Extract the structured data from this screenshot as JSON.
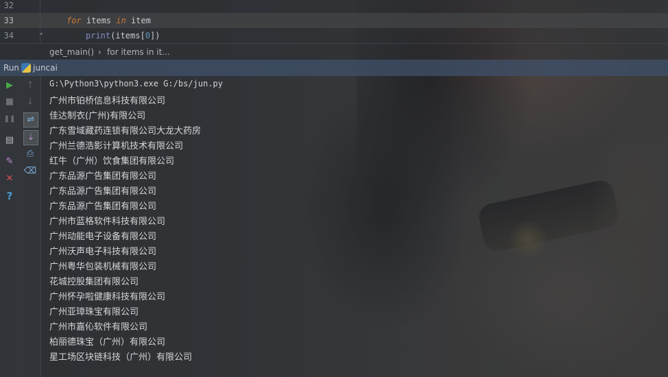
{
  "editor": {
    "lines": [
      {
        "num": "32"
      },
      {
        "num": "33",
        "kw_for": "for",
        "var": " items ",
        "kw_in": "in",
        "iter": " item"
      },
      {
        "num": "34",
        "func": "print",
        "arg_open": "(items[",
        "index": "0",
        "arg_close": "])"
      }
    ],
    "breadcrumb": {
      "function": "get_main()",
      "separator": "›",
      "block": "for items in it..."
    }
  },
  "run_panel": {
    "label": "Run",
    "config_name": "juncai",
    "toolbar_left": [
      {
        "icon": "run-icon",
        "glyph": "▶",
        "color": "#4ca64c"
      },
      {
        "icon": "stop-icon",
        "glyph": "■",
        "color": "#6b6f73"
      },
      {
        "icon": "pause-icon",
        "glyph": "❚❚",
        "color": "#6b6f73"
      },
      {
        "icon": "restore-layout-icon",
        "glyph": "▤",
        "color": "#b8bcc0"
      },
      {
        "icon": "pin-icon",
        "glyph": "✎",
        "color": "#c58ad8"
      },
      {
        "icon": "close-icon",
        "glyph": "✕",
        "color": "#d9534f"
      },
      {
        "icon": "help-icon",
        "glyph": "?",
        "color": "#4a9fd6"
      }
    ],
    "toolbar_right": [
      {
        "icon": "up-arrow-icon",
        "glyph": "↑",
        "color": "#5a5e62"
      },
      {
        "icon": "down-arrow-icon",
        "glyph": "↓",
        "color": "#5a5e62"
      },
      {
        "icon": "soft-wrap-icon",
        "glyph": "⇌",
        "color": "#7fb2e0"
      },
      {
        "icon": "scroll-to-end-icon",
        "glyph": "⇣",
        "color": "#b78ad0"
      },
      {
        "icon": "print-icon",
        "glyph": "⎙",
        "color": "#7fb2e0"
      },
      {
        "icon": "clear-all-icon",
        "glyph": "🗑",
        "color": "#7fb2e0"
      }
    ],
    "command": "G:\\Python3\\python3.exe G:/bs/jun.py",
    "output": [
      "广州市铂桥信息科技有限公司",
      "佳达制衣(广州)有限公司",
      "广东雪域藏药连锁有限公司大龙大药房",
      "广州兰德浩影计算机技术有限公司",
      "红牛（广州）饮食集团有限公司",
      "广东品源广告集团有限公司",
      "广东品源广告集团有限公司",
      "广东品源广告集团有限公司",
      "广州市蓝格软件科技有限公司",
      "广州动能电子设备有限公司",
      "广州沃声电子科技有限公司",
      "广州粤华包装机械有限公司",
      "花城控股集团有限公司",
      "广州怀孕啦健康科技有限公司",
      "广州亚璋珠宝有限公司",
      "广州市嘉伈软件有限公司",
      "柏丽德珠宝（广州）有限公司",
      "星工场区块链科技（广州）有限公司"
    ]
  },
  "colors": {
    "keyword": "#cc7832",
    "builtin": "#8888c6",
    "number": "#6897bb",
    "run_bar": "#3c4a60"
  }
}
